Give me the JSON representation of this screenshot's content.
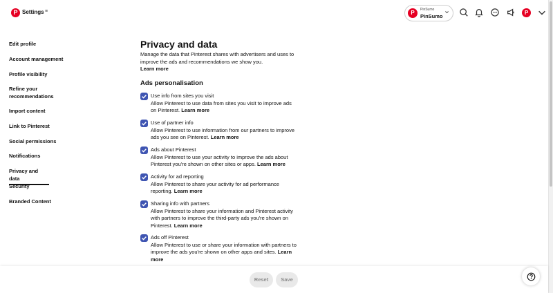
{
  "header": {
    "title": "Settings",
    "menu_icon": "≡",
    "logo_letter": "P",
    "account": {
      "small_label": "PinSumo",
      "name": "PinSumo",
      "avatar_letter": "P"
    },
    "user_avatar_letter": "P",
    "icons": [
      "search-icon",
      "notifications-icon",
      "messages-icon",
      "announcements-icon",
      "chevron-down-icon"
    ]
  },
  "sidebar": {
    "items": [
      {
        "label": "Edit profile"
      },
      {
        "label": "Account management"
      },
      {
        "label": "Profile visibility"
      },
      {
        "label": "Refine your recommendations"
      },
      {
        "label": "Import content"
      },
      {
        "label": "Link to Pinterest"
      },
      {
        "label": "Social permissions"
      },
      {
        "label": "Notifications"
      },
      {
        "label": "Privacy and data"
      },
      {
        "label": "Security"
      },
      {
        "label": "Branded Content"
      }
    ],
    "active": "Privacy and data"
  },
  "main": {
    "title": "Privacy and data",
    "description": "Manage the data that Pinterest shares with advertisers and uses to improve the ads and recommendations we show you.",
    "description_link": "Learn more",
    "section_title": "Ads personalisation",
    "options": [
      {
        "title": "Use info from sites you visit",
        "desc": "Allow Pinterest to use data from sites you visit to improve ads on Pinterest.",
        "link": "Learn more",
        "checked": true
      },
      {
        "title": "Use of partner info",
        "desc": "Allow Pinterest to use information from our partners to improve ads you see on Pinterest.",
        "link": "Learn more",
        "checked": true
      },
      {
        "title": "Ads about Pinterest",
        "desc": "Allow Pinterest to use your activity to improve the ads about Pinterest you're shown on other sites or apps.",
        "link": "Learn more",
        "checked": true
      },
      {
        "title": "Activity for ad reporting",
        "desc": "Allow Pinterest to share your activity for ad performance reporting.",
        "link": "Learn more",
        "checked": true
      },
      {
        "title": "Sharing info with partners",
        "desc": "Allow Pinterest to share your information and Pinterest activity with partners to improve the third-party ads you're shown on Pinterest.",
        "link": "Learn more",
        "checked": true
      },
      {
        "title": "Ads off Pinterest",
        "desc": "Allow Pinterest to use or share your information with partners to improve the ads you're shown on other apps and sites.",
        "link": "Learn more",
        "checked": true
      }
    ]
  },
  "footer": {
    "reset_label": "Reset",
    "save_label": "Save",
    "help_icon": "?"
  },
  "colors": {
    "brand": "#e60023",
    "checkbox": "#3f55b2",
    "button_bg": "#e9e9e9",
    "button_text": "#8e8e8e"
  }
}
